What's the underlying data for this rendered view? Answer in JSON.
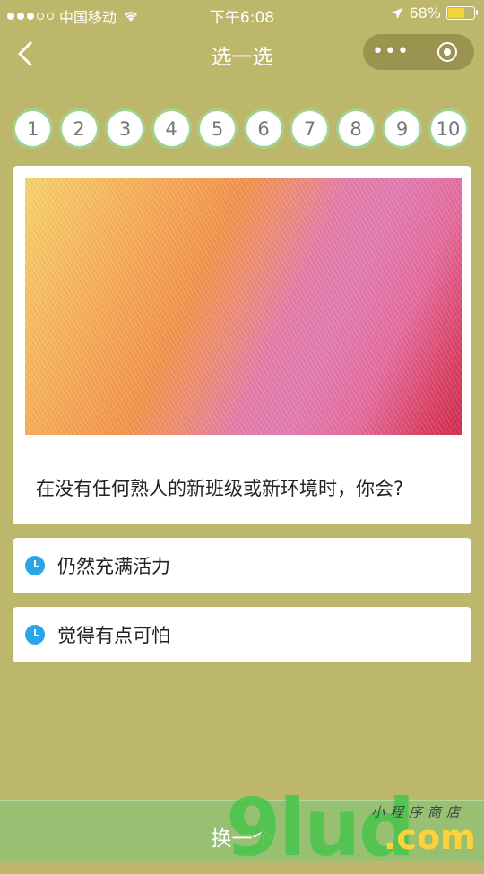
{
  "status_bar": {
    "carrier": "中国移动",
    "time": "下午6:08",
    "battery": "68%"
  },
  "nav": {
    "title": "选一选",
    "more_label": "•••"
  },
  "numbers": [
    "1",
    "2",
    "3",
    "4",
    "5",
    "6",
    "7",
    "8",
    "9",
    "10"
  ],
  "question": {
    "text": "在没有任何熟人的新班级或新环境时，你会?"
  },
  "options": [
    {
      "label": "仍然充满活力",
      "icon": "clock-icon"
    },
    {
      "label": "觉得有点可怕",
      "icon": "clock-icon"
    }
  ],
  "bottom_button": {
    "label": "换一个"
  },
  "watermark": {
    "brand": "9lud",
    "domain": ".com",
    "tagline": "小程序商店"
  },
  "colors": {
    "background": "#bcb76a",
    "number_border": "#a3cf8f",
    "option_icon": "#2aa6e8",
    "bottom_button": "#97c072"
  }
}
